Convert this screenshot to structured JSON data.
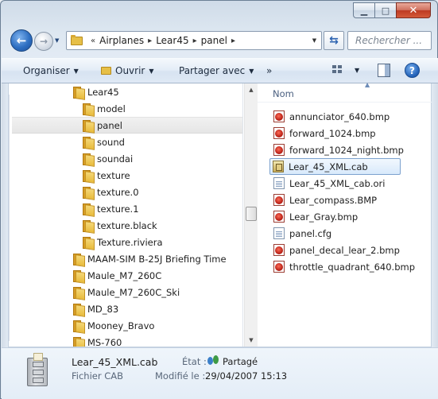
{
  "window": {
    "minimize_glyph": "▁",
    "maximize_glyph": "□",
    "close_glyph": "✕"
  },
  "navigation": {
    "back_glyph": "←",
    "forward_glyph": "→",
    "breadcrumb": [
      "Airplanes",
      "Lear45",
      "panel"
    ],
    "breadcrumb_prefix": "«",
    "search_placeholder": "Rechercher ..."
  },
  "toolbar": {
    "organize": "Organiser",
    "open": "Ouvrir",
    "share_with": "Partager avec",
    "more": "»",
    "help": "?"
  },
  "nav_tree": [
    {
      "label": "Lear45",
      "level": 0,
      "selected": false
    },
    {
      "label": "model",
      "level": 1,
      "selected": false
    },
    {
      "label": "panel",
      "level": 1,
      "selected": true
    },
    {
      "label": "sound",
      "level": 1,
      "selected": false
    },
    {
      "label": "soundai",
      "level": 1,
      "selected": false
    },
    {
      "label": "texture",
      "level": 1,
      "selected": false
    },
    {
      "label": "texture.0",
      "level": 1,
      "selected": false
    },
    {
      "label": "texture.1",
      "level": 1,
      "selected": false
    },
    {
      "label": "texture.black",
      "level": 1,
      "selected": false
    },
    {
      "label": "Texture.riviera",
      "level": 1,
      "selected": false
    },
    {
      "label": "MAAM-SIM B-25J Briefing Time",
      "level": 0,
      "selected": false
    },
    {
      "label": "Maule_M7_260C",
      "level": 0,
      "selected": false
    },
    {
      "label": "Maule_M7_260C_Ski",
      "level": 0,
      "selected": false
    },
    {
      "label": "MD_83",
      "level": 0,
      "selected": false
    },
    {
      "label": "Mooney_Bravo",
      "level": 0,
      "selected": false
    },
    {
      "label": "MS-760",
      "level": 0,
      "selected": false
    }
  ],
  "file_list": {
    "column_name": "Nom",
    "files": [
      {
        "name": "annunciator_640.bmp",
        "icon": "bmp-icon",
        "selected": false
      },
      {
        "name": "forward_1024.bmp",
        "icon": "bmp-icon",
        "selected": false
      },
      {
        "name": "forward_1024_night.bmp",
        "icon": "bmp-icon",
        "selected": false
      },
      {
        "name": "Lear_45_XML.cab",
        "icon": "cab-icon",
        "selected": true
      },
      {
        "name": "Lear_45_XML_cab.ori",
        "icon": "document-icon",
        "selected": false
      },
      {
        "name": "Lear_compass.BMP",
        "icon": "bmp-icon",
        "selected": false
      },
      {
        "name": "Lear_Gray.bmp",
        "icon": "bmp-icon",
        "selected": false
      },
      {
        "name": "panel.cfg",
        "icon": "document-icon",
        "selected": false
      },
      {
        "name": "panel_decal_lear_2.bmp",
        "icon": "bmp-icon",
        "selected": false
      },
      {
        "name": "throttle_quadrant_640.bmp",
        "icon": "bmp-icon",
        "selected": false
      }
    ]
  },
  "details": {
    "file_name": "Lear_45_XML.cab",
    "file_type": "Fichier CAB",
    "state_label": "État :",
    "state_value": "Partagé",
    "modified_label": "Modifié le :",
    "modified_value": "29/04/2007 15:13"
  },
  "colors": {
    "selection_border": "#7da2ce",
    "window_frame": "#dde7f1",
    "close_button": "#bd3a22"
  }
}
